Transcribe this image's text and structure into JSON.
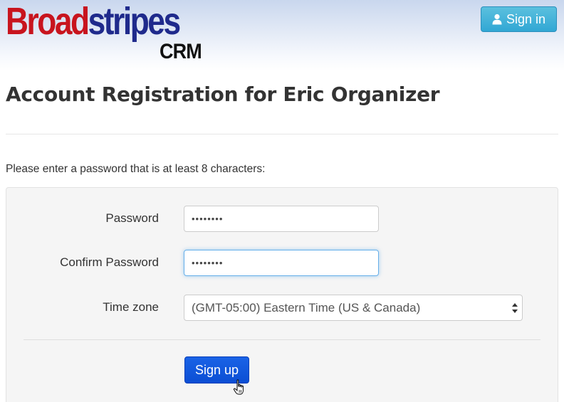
{
  "header": {
    "logo": {
      "word_part1": "Broad",
      "word_part2": "stripes",
      "subtitle": "CRM"
    },
    "signin_button": {
      "label": "Sign in",
      "icon": "user-icon"
    }
  },
  "page_title": "Account Registration for Eric Organizer",
  "instructions": "Please enter a password that is at least 8 characters:",
  "form": {
    "password": {
      "label": "Password",
      "value": "••••••••"
    },
    "confirm_password": {
      "label": "Confirm Password",
      "value": "••••••••"
    },
    "time_zone": {
      "label": "Time zone",
      "selected": "(GMT-05:00) Eastern Time (US & Canada)"
    },
    "submit_label": "Sign up"
  },
  "colors": {
    "logo_red": "#c8141e",
    "logo_blue": "#1f2a8c",
    "signin_button": "#31a7d4",
    "signup_button": "#0b4ed4",
    "focus_ring": "#66afe9"
  }
}
